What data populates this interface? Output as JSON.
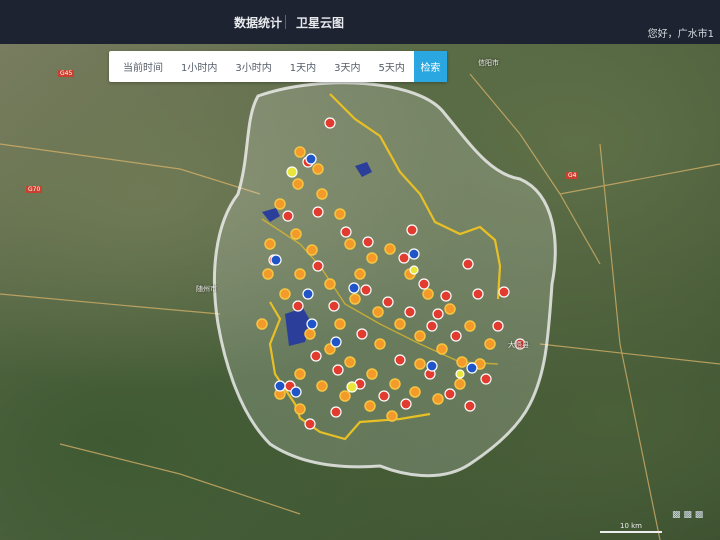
{
  "header": {
    "tab_stats": "数据统计",
    "tab_satellite": "卫星云图",
    "greeting": "您好，广水市1"
  },
  "filters": {
    "items": [
      "当前时间",
      "1小时内",
      "3小时内",
      "1天内",
      "3天内",
      "5天内"
    ],
    "search_label": "检索"
  },
  "map": {
    "place_labels": [
      "信阳市",
      "随州市",
      "大悟县"
    ],
    "road_labels": [
      "G45",
      "G70",
      "G4"
    ],
    "scale_label": "10 km",
    "marker_colors": {
      "red": "#e23b2f",
      "orange": "#f39a2a",
      "blue": "#1f55c8",
      "yellow": "#e9e53a",
      "ring": "#f4c542"
    }
  }
}
